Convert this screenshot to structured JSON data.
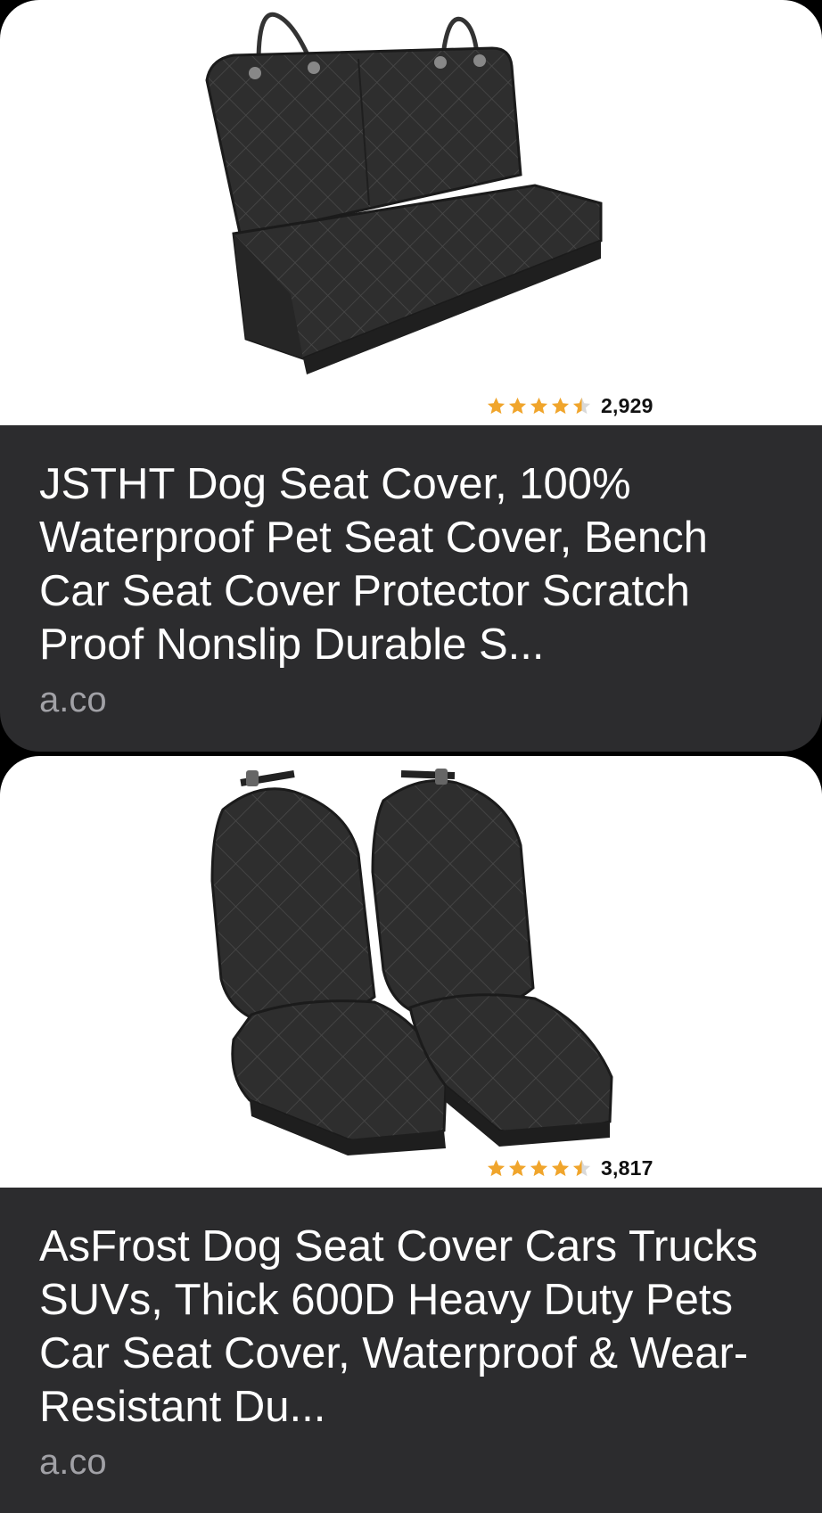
{
  "results": [
    {
      "image_icon": "bench-seat-cover-image",
      "rating_stars": 4.5,
      "rating_count": "2,929",
      "title": "JSTHT Dog Seat Cover, 100% Waterproof Pet Seat Cover, Bench Car Seat Cover Protector Scratch Proof Nonslip Durable S...",
      "domain": "a.co"
    },
    {
      "image_icon": "bucket-seat-covers-image",
      "rating_stars": 4.5,
      "rating_count": "3,817",
      "title": "AsFrost Dog Seat Cover Cars Trucks SUVs, Thick 600D Heavy Duty Pets Car Seat Cover, Waterproof & Wear-Resistant Du...",
      "domain": "a.co"
    }
  ],
  "colors": {
    "card_background": "#2c2c2e",
    "star": "#f0a52c",
    "star_empty": "#d9d9d9",
    "domain_text": "#a1a1a6"
  }
}
